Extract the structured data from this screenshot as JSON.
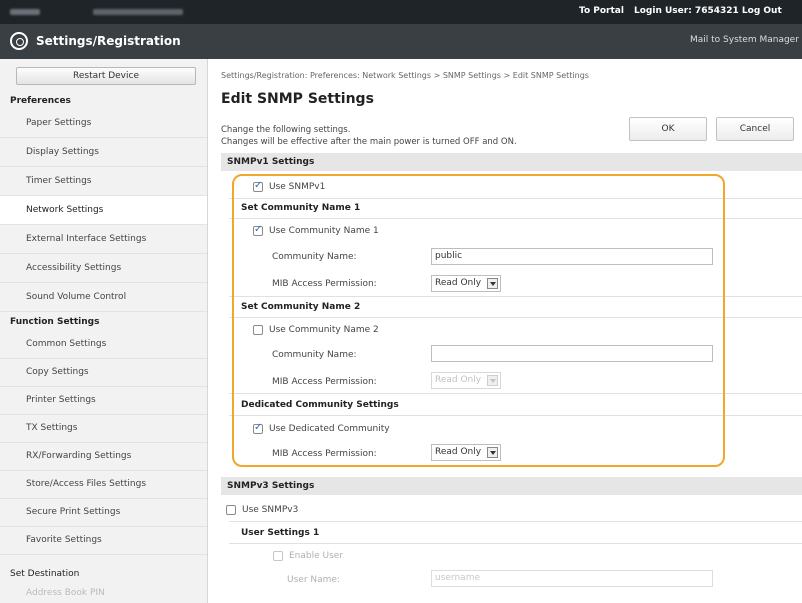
{
  "topbar": {
    "to_portal": "To Portal",
    "login": "Login User: 7654321 Log Out"
  },
  "header": {
    "title": "Settings/Registration",
    "mail": "Mail to System Manager"
  },
  "sidebar": {
    "restart": "Restart Device",
    "section_preferences": "Preferences",
    "preferences": [
      "Paper Settings",
      "Display Settings",
      "Timer Settings",
      "Network Settings",
      "External Interface Settings",
      "Accessibility Settings",
      "Sound Volume Control"
    ],
    "section_function": "Function Settings",
    "functions": [
      "Common Settings",
      "Copy Settings",
      "Printer Settings",
      "TX Settings",
      "RX/Forwarding Settings",
      "Store/Access Files Settings",
      "Secure Print Settings",
      "Favorite Settings"
    ],
    "section_destination": "Set Destination",
    "destination": [
      "Address Book PIN"
    ]
  },
  "main": {
    "breadcrumb": "Settings/Registration: Preferences: Network Settings > SNMP Settings > Edit SNMP Settings",
    "title": "Edit SNMP Settings",
    "desc1": "Change the following settings.",
    "desc2": "Changes will be effective after the main power is turned OFF and ON.",
    "ok": "OK",
    "cancel": "Cancel",
    "snmpv1": {
      "header": "SNMPv1 Settings",
      "use": "Use SNMPv1",
      "c1_header": "Set Community Name 1",
      "c1_use": "Use Community Name 1",
      "c1_name_label": "Community Name:",
      "c1_name_value": "public",
      "c1_mib_label": "MIB Access Permission:",
      "c1_mib_value": "Read Only",
      "c2_header": "Set Community Name 2",
      "c2_use": "Use Community Name 2",
      "c2_name_label": "Community Name:",
      "c2_name_value": "",
      "c2_mib_label": "MIB Access Permission:",
      "c2_mib_value": "Read Only",
      "ded_header": "Dedicated Community Settings",
      "ded_use": "Use Dedicated Community",
      "ded_mib_label": "MIB Access Permission:",
      "ded_mib_value": "Read Only"
    },
    "snmpv3": {
      "header": "SNMPv3 Settings",
      "use": "Use SNMPv3",
      "user1_header": "User Settings 1",
      "enable_user": "Enable User",
      "user_name_label": "User Name:",
      "user_name_value": "username"
    }
  },
  "colors": {
    "highlight": "#f0a82c",
    "topbar": "#1f2428",
    "header": "#3a3f44"
  }
}
